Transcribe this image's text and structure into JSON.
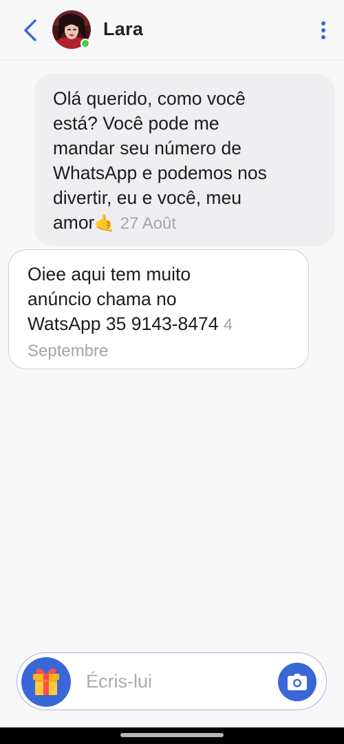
{
  "header": {
    "contact_name": "Lara",
    "online": true,
    "icons": {
      "back": "chevron-left-icon",
      "menu": "more-vertical-icon"
    },
    "accent_color": "#3a67d8"
  },
  "messages": [
    {
      "direction": "incoming",
      "text": "Olá querido, como você\nestá?  Você pode me\nmandar seu número de\nWhatsApp e podemos nos\ndivertir, eu e você, meu\namor",
      "emoji": "🤙",
      "time": "27 Août"
    },
    {
      "direction": "outgoing",
      "text": "Oiee aqui tem muito\nanúncio chama no\nWatsApp 35 9143-8474",
      "time": "4 Septembre"
    }
  ],
  "composer": {
    "placeholder": "Écris-lui",
    "value": "",
    "icons": {
      "gift": "gift-icon",
      "camera": "camera-icon"
    }
  }
}
